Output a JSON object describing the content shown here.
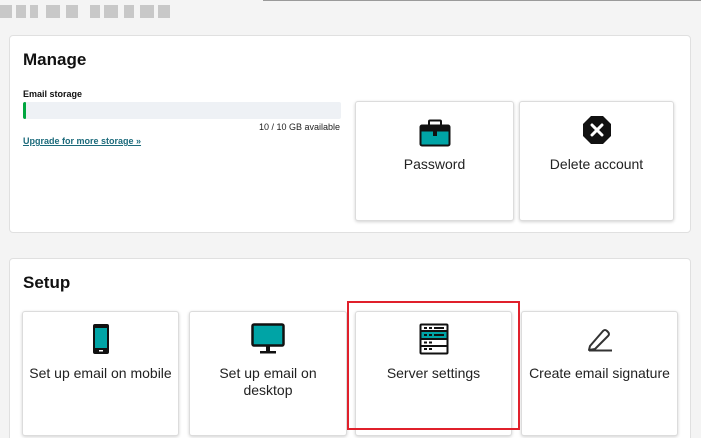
{
  "manage": {
    "title": "Manage",
    "storage_label": "Email storage",
    "storage_fraction": 0.01,
    "storage_text": "10 / 10 GB available",
    "upgrade_link": "Upgrade for more storage »",
    "tiles": [
      {
        "label": "Password",
        "icon": "briefcase-lock-icon"
      },
      {
        "label": "Delete account",
        "icon": "x-octagon-icon"
      }
    ]
  },
  "setup": {
    "title": "Setup",
    "tiles": [
      {
        "label": "Set up email on mobile",
        "icon": "mobile-phone-icon"
      },
      {
        "label": "Set up email on desktop",
        "icon": "desktop-monitor-icon"
      },
      {
        "label": "Server settings",
        "icon": "server-icon"
      },
      {
        "label": "Create email signature",
        "icon": "pencil-icon"
      }
    ]
  },
  "colors": {
    "accent_teal": "#00a4a6",
    "link": "#1b6a7b",
    "progress_green": "#00a63f",
    "highlight_red": "#e0202b"
  }
}
